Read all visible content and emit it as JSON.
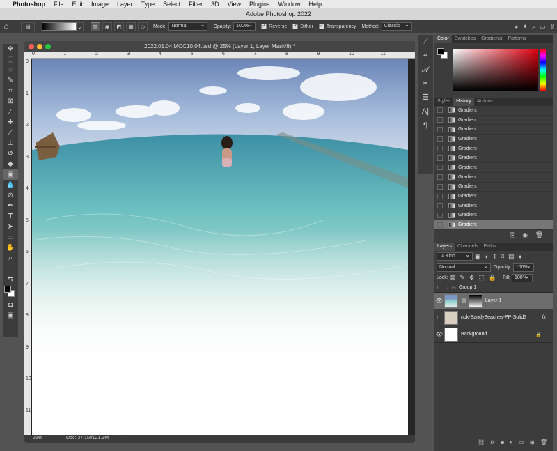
{
  "menubar": {
    "app": "Photoshop",
    "items": [
      "File",
      "Edit",
      "Image",
      "Layer",
      "Type",
      "Select",
      "Filter",
      "3D",
      "View",
      "Plugins",
      "Window",
      "Help"
    ]
  },
  "window_title": "Adobe Photoshop 2022",
  "options": {
    "mode_label": "Mode:",
    "mode_value": "Normal",
    "opacity_label": "Opacity:",
    "opacity_value": "100%",
    "reverse_label": "Reverse",
    "dither_label": "Dither",
    "transparency_label": "Transparency",
    "method_label": "Method:",
    "method_value": "Classic"
  },
  "document": {
    "title": "2022.01.04 MOC10.04.psd @ 25% (Layer 1, Layer Mask/8) *",
    "ruler_h": [
      "0",
      "1",
      "2",
      "3",
      "4",
      "5",
      "6",
      "7",
      "8",
      "9",
      "10",
      "11"
    ],
    "ruler_v": [
      "0",
      "1",
      "2",
      "3",
      "4",
      "5",
      "6",
      "7",
      "8",
      "9",
      "10",
      "11"
    ],
    "zoom": "25%",
    "doc_size": "Doc: 37.1M/121.3M"
  },
  "color_panel": {
    "tabs": [
      "Color",
      "Swatches",
      "Gradients",
      "Patterns"
    ],
    "active_tab": "Color",
    "foreground": "#000000",
    "background": "#ffffff"
  },
  "history_panel": {
    "tabs": [
      "Styles",
      "History",
      "Actions"
    ],
    "active_tab": "History",
    "items": [
      "Gradient",
      "Gradient",
      "Gradient",
      "Gradient",
      "Gradient",
      "Gradient",
      "Gradient",
      "Gradient",
      "Gradient",
      "Gradient",
      "Gradient",
      "Gradient",
      "Gradient"
    ]
  },
  "layers_panel": {
    "tabs": [
      "Layers",
      "Channels",
      "Paths"
    ],
    "active_tab": "Layers",
    "kind": "Kind",
    "blend_mode": "Normal",
    "opacity_label": "Opacity:",
    "opacity_value": "100%",
    "lock_label": "Lock:",
    "fill_label": "Fill:",
    "fill_value": "100%",
    "layers": [
      {
        "name": "Group 1",
        "visible": false
      },
      {
        "name": "Layer 1",
        "visible": true,
        "selected": true
      },
      {
        "name": "nbk-SandyBeaches-PP-Solid3",
        "visible": false
      },
      {
        "name": "Background",
        "visible": true
      }
    ],
    "fx_label": "fx"
  }
}
